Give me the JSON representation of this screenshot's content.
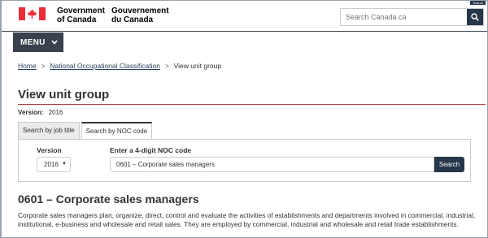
{
  "header": {
    "signature_en_line1": "Government",
    "signature_en_line2": "of Canada",
    "signature_fr_line1": "Gouvernement",
    "signature_fr_line2": "du Canada",
    "search_placeholder": "Search Canada.ca",
    "skip_label": "Search"
  },
  "nav": {
    "menu_label": "MENU"
  },
  "breadcrumb": {
    "home": "Home",
    "noc": "National Occupational Classification",
    "current": "View unit group",
    "separator": ">"
  },
  "page": {
    "title": "View unit group",
    "version_label": "Version:",
    "version_value": "2016"
  },
  "tabs": {
    "by_job_title": "Search by job title",
    "by_noc_code": "Search by NOC code",
    "active": "by_noc_code"
  },
  "form": {
    "version_label": "Version",
    "version_selected": "2016",
    "noc_label": "Enter a 4-digit NOC code",
    "noc_value": "0601 – Corporate sales managers",
    "search_button": "Search"
  },
  "unit_group": {
    "title": "0601 – Corporate sales managers",
    "description": "Corporate sales managers plan, organize, direct, control and evaluate the activities of establishments and departments involved in commercial, industrial, institutional, e-business and wholesale and retail sales. They are employed by commercial, industrial and wholesale and retail trade establishments."
  },
  "colors": {
    "flag_red": "#eb2d37",
    "dark_blue": "#26374a",
    "menu_bg": "#38414d",
    "link": "#284162",
    "title_rule": "#af3c43"
  }
}
